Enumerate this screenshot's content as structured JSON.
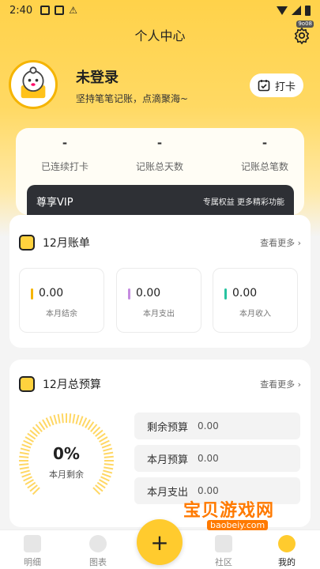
{
  "status_bar": {
    "time": "2:40",
    "badge": "9o08"
  },
  "header": {
    "title": "个人中心"
  },
  "profile": {
    "name": "未登录",
    "subtitle": "坚持笔笔记账，点滴聚海~",
    "checkin_label": "打卡"
  },
  "stats": [
    {
      "value": "-",
      "label": "已连续打卡"
    },
    {
      "value": "-",
      "label": "记账总天数"
    },
    {
      "value": "-",
      "label": "记账总笔数"
    }
  ],
  "vip": {
    "title": "尊享VIP",
    "right_text": "专属权益 更多精彩功能"
  },
  "bill": {
    "title": "12月账单",
    "more": "查看更多 ›",
    "items": [
      {
        "value": "0.00",
        "label": "本月结余",
        "color": "#f5b400"
      },
      {
        "value": "0.00",
        "label": "本月支出",
        "color": "#c58be0"
      },
      {
        "value": "0.00",
        "label": "本月收入",
        "color": "#27c3a0"
      }
    ]
  },
  "budget": {
    "title": "12月总预算",
    "more": "查看更多 ›",
    "percent_text": "0%",
    "percent_value": 0,
    "ring_label": "本月剩余",
    "rows": [
      {
        "label": "剩余预算",
        "value": "0.00"
      },
      {
        "label": "本月预算",
        "value": "0.00"
      },
      {
        "label": "本月支出",
        "value": "0.00"
      }
    ]
  },
  "tabs": [
    {
      "label": "明细"
    },
    {
      "label": "图表"
    },
    {
      "label": "+"
    },
    {
      "label": "社区"
    },
    {
      "label": "我的"
    }
  ],
  "watermark": {
    "name": "宝贝游戏网",
    "url": "baobeiy.com"
  },
  "colors": {
    "accent": "#ffcb2e",
    "page_bg": "#f4f4f4"
  }
}
